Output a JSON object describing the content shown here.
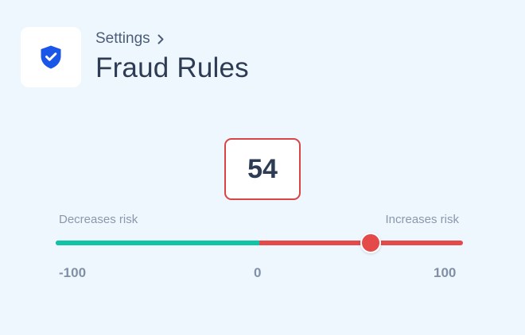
{
  "header": {
    "icon": "shield-check-icon",
    "breadcrumb": "Settings",
    "title": "Fraud Rules"
  },
  "slider": {
    "value": 54,
    "value_label": "54",
    "min": -100,
    "max": 100,
    "min_label": "-100",
    "zero_label": "0",
    "max_label": "100",
    "left_caption": "Decreases risk",
    "right_caption": "Increases risk"
  },
  "colors": {
    "background": "#eef7fd",
    "brand_blue": "#1a56e8",
    "negative_track": "#10c2a6",
    "positive_track": "#e44a4a",
    "value_border": "#d94545",
    "text_dark": "#2e3b55",
    "text_muted": "#8a97ad"
  }
}
